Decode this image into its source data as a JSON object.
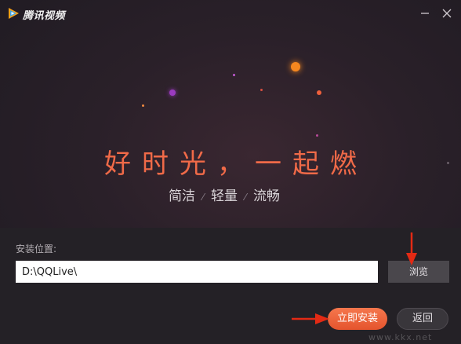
{
  "window": {
    "app_title": "腾讯视频",
    "minimize_icon": "minimize-icon",
    "close_icon": "close-icon"
  },
  "hero": {
    "slogan": "好时光，一起燃",
    "subtitle_parts": [
      "简洁",
      "轻量",
      "流畅"
    ]
  },
  "install": {
    "location_label": "安装位置:",
    "path_value": "D:\\QQLive\\",
    "browse_label": "浏览",
    "install_label": "立即安装",
    "back_label": "返回"
  },
  "watermark": "www.kkx.net",
  "colors": {
    "accent": "#f06a48",
    "install_button": "#ee6a44",
    "background": "#261f27"
  }
}
